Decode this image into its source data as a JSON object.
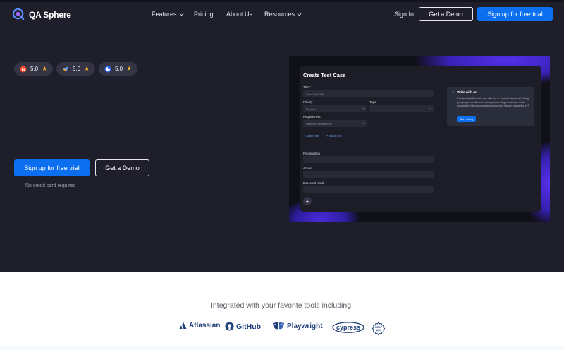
{
  "brand": {
    "name": "QA Sphere"
  },
  "nav": {
    "features": "Features",
    "pricing": "Pricing",
    "about": "About Us",
    "resources": "Resources",
    "sign_in": "Sign In",
    "get_demo": "Get a Demo",
    "signup": "Sign up for free trial"
  },
  "ratings": [
    {
      "icon": "g2-icon",
      "score": "5.0",
      "star": "★"
    },
    {
      "icon": "capterra-icon",
      "score": "5.0",
      "star": "★"
    },
    {
      "icon": "review-site-icon",
      "score": "5.0",
      "star": "★"
    }
  ],
  "hero": {
    "signup": "Sign up for free trial",
    "demo": "Get a Demo",
    "note": "No credit card required"
  },
  "preview": {
    "title": "Create Test Case",
    "title_label": "Title *",
    "title_placeholder": "Test Case Title",
    "priority_label": "Priority",
    "priority_value": "Medium",
    "tags_label": "Tags",
    "requirement_label": "Requirement",
    "requirement_placeholder": "Select or create new",
    "attach_file": "+ Attach file",
    "attach_link": "↗ Attach link",
    "precondition": "Precondition",
    "action": "Action",
    "expected": "Expected result",
    "add": "+",
    "ai_title": "Write with AI",
    "ai_body": "Create a detailed test case with our AI-powered assistant. Using your project details and your input, our AI generates an initial description that you can easily customize. Ready to give it a try?",
    "ai_button": "Start writing"
  },
  "integrations": {
    "heading": "Integrated with your favorite tools including:",
    "atlassian": "Atlassian",
    "github": "GitHub",
    "playwright": "Playwright",
    "cypress": "cypress",
    "rest_api_top": "REST",
    "rest_api_bottom": "API"
  },
  "colors": {
    "hero_bg": "#1f1f2c",
    "primary": "#0b6ff0",
    "star": "#f5b72b",
    "integration_logo": "#1f3f7a"
  }
}
